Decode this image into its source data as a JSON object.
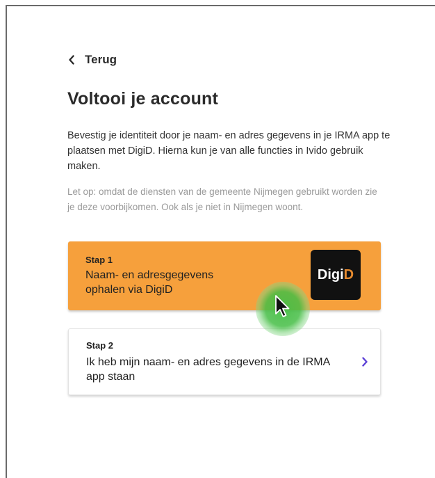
{
  "nav": {
    "back_label": "Terug",
    "back_icon": "chevron-left-icon"
  },
  "page": {
    "title": "Voltooi je account",
    "intro": "Bevestig je identiteit door je naam- en adres gegevens in je IRMA app te plaatsen met DigiD. Hierna kun je van alle functies in Ivido gebruik maken.",
    "note": "Let op: omdat de diensten van de gemeente Nijmegen gebruikt worden zie je deze voorbijkomen. Ook als je niet in Nijmegen woont."
  },
  "steps": [
    {
      "label": "Stap 1",
      "text": "Naam- en adresgegevens ophalen via DigiD",
      "logo_prefix": "Digi",
      "logo_accent": "D",
      "background": "#f6a03c"
    },
    {
      "label": "Stap 2",
      "text": "Ik heb mijn naam- en adres gegevens in de IRMA app staan",
      "icon": "chevron-right-icon",
      "icon_color": "#5b3fd6"
    }
  ],
  "colors": {
    "accent_orange": "#f6a03c",
    "chevron_purple": "#5b3fd6",
    "cursor_highlight": "#46be46"
  }
}
